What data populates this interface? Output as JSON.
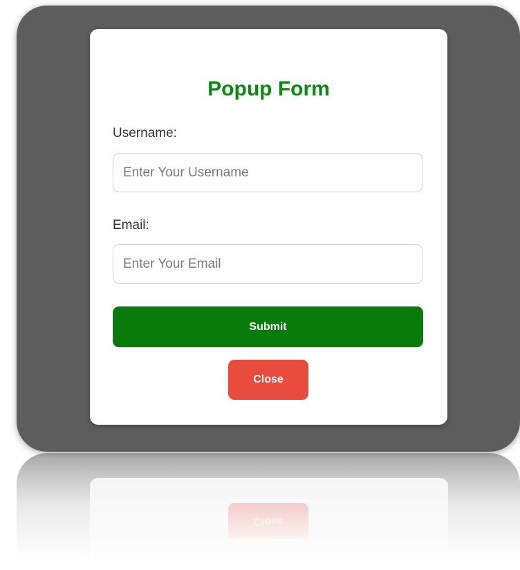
{
  "popup": {
    "title": "Popup Form",
    "username_label": "Username:",
    "username_placeholder": "Enter Your Username",
    "username_value": "",
    "email_label": "Email:",
    "email_placeholder": "Enter Your Email",
    "email_value": "",
    "submit_label": "Submit",
    "close_label": "Close"
  },
  "colors": {
    "title": "#0a8a12",
    "submit": "#087b0b",
    "close": "#e74c3c",
    "backdrop": "#5d5d5d"
  }
}
